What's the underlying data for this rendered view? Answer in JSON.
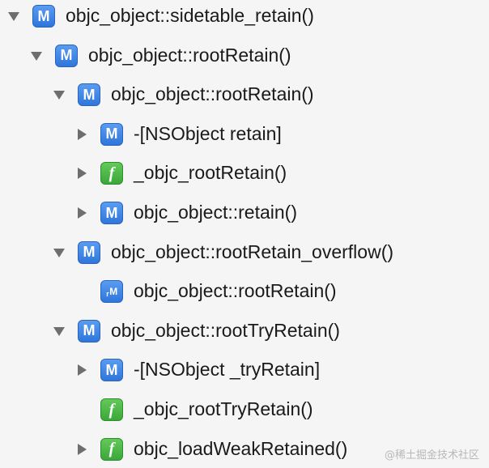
{
  "tree": {
    "rows": [
      {
        "label": "objc_object::sidetable_retain()",
        "icon": "M",
        "icon_type": "method",
        "disclosure": "expanded",
        "depth": 0
      },
      {
        "label": "objc_object::rootRetain()",
        "icon": "M",
        "icon_type": "method",
        "disclosure": "expanded",
        "depth": 1
      },
      {
        "label": "objc_object::rootRetain()",
        "icon": "M",
        "icon_type": "method",
        "disclosure": "expanded",
        "depth": 2
      },
      {
        "label": "-[NSObject retain]",
        "icon": "M",
        "icon_type": "method",
        "disclosure": "collapsed",
        "depth": 3
      },
      {
        "label": "_objc_rootRetain()",
        "icon": "f",
        "icon_type": "function",
        "disclosure": "collapsed",
        "depth": 3
      },
      {
        "label": "objc_object::retain()",
        "icon": "M",
        "icon_type": "method",
        "disclosure": "collapsed",
        "depth": 3
      },
      {
        "label": "objc_object::rootRetain_overflow()",
        "icon": "M",
        "icon_type": "method",
        "disclosure": "expanded",
        "depth": 2
      },
      {
        "label": "objc_object::rootRetain()",
        "icon": "rM",
        "icon_type": "recursive",
        "disclosure": "none",
        "depth": 3
      },
      {
        "label": "objc_object::rootTryRetain()",
        "icon": "M",
        "icon_type": "method",
        "disclosure": "expanded",
        "depth": 2
      },
      {
        "label": "-[NSObject _tryRetain]",
        "icon": "M",
        "icon_type": "method",
        "disclosure": "collapsed",
        "depth": 3
      },
      {
        "label": "_objc_rootTryRetain()",
        "icon": "f",
        "icon_type": "function",
        "disclosure": "none",
        "depth": 3
      },
      {
        "label": "objc_loadWeakRetained()",
        "icon": "f",
        "icon_type": "function",
        "disclosure": "collapsed",
        "depth": 3
      }
    ]
  },
  "watermark": "@稀土掘金技术社区",
  "colors": {
    "background": "#f5f5f5",
    "method_icon": "#2f76dc",
    "function_icon": "#3ba83a",
    "disclosure": "#6e6e6e",
    "text": "#1a1a1a"
  }
}
